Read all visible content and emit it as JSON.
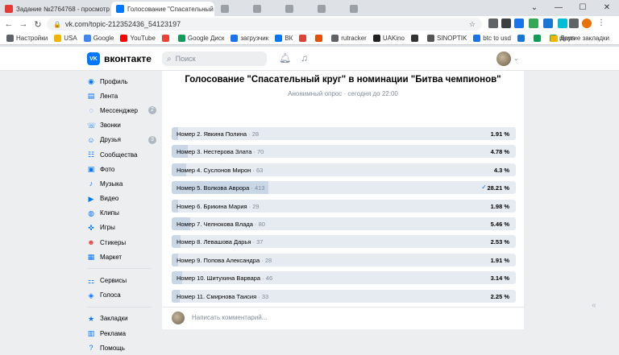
{
  "browser": {
    "tabs": [
      {
        "title": "Задание №2764768 - просмотр з",
        "icon": "sp-icon",
        "color": "#e53935"
      },
      {
        "title": "Голосование \"Спасательный круг",
        "icon": "vk-icon",
        "color": "#0077ff"
      },
      {
        "title": "",
        "icon": "page-icon",
        "color": "#9aa0a6"
      },
      {
        "title": "",
        "icon": "page-icon",
        "color": "#9aa0a6"
      },
      {
        "title": "",
        "icon": "page-icon",
        "color": "#9aa0a6"
      },
      {
        "title": "",
        "icon": "page-icon",
        "color": "#9aa0a6"
      },
      {
        "title": "",
        "icon": "page-icon",
        "color": "#9aa0a6"
      }
    ],
    "url": "vk.com/topic-212352436_54123197",
    "bookmarks": [
      {
        "label": "Настройки",
        "color": "#5f6368"
      },
      {
        "label": "USA",
        "color": "#f4b400"
      },
      {
        "label": "Google",
        "color": "#4285f4"
      },
      {
        "label": "YouTube",
        "color": "#ff0000"
      },
      {
        "label": "",
        "color": "#ea4335"
      },
      {
        "label": "Google Диск",
        "color": "#0f9d58"
      },
      {
        "label": "загрузчик",
        "color": "#1a73e8"
      },
      {
        "label": "ВК",
        "color": "#0077ff"
      },
      {
        "label": "",
        "color": "#db4437"
      },
      {
        "label": "",
        "color": "#e65100"
      },
      {
        "label": "rutracker",
        "color": "#5f6368"
      },
      {
        "label": "UAKino",
        "color": "#222222"
      },
      {
        "label": "",
        "color": "#333333"
      },
      {
        "label": "SINOPTIK",
        "color": "#555555"
      },
      {
        "label": "btc to usd",
        "color": "#1a73e8"
      },
      {
        "label": "",
        "color": "#1976d2"
      },
      {
        "label": "",
        "color": "#0f9d58"
      },
      {
        "label": "maps",
        "color": "#34a853"
      }
    ],
    "other_bookmarks": "Другие закладки"
  },
  "vk": {
    "logo_text": "вконтакте",
    "search_placeholder": "Поиск",
    "sidebar": [
      {
        "label": "Профиль",
        "icon": "profile-icon",
        "badge": ""
      },
      {
        "label": "Лента",
        "icon": "feed-icon",
        "badge": ""
      },
      {
        "label": "Мессенджер",
        "icon": "messenger-icon",
        "badge": "2"
      },
      {
        "label": "Звонки",
        "icon": "calls-icon",
        "badge": ""
      },
      {
        "label": "Друзья",
        "icon": "friends-icon",
        "badge": "3"
      },
      {
        "label": "Сообщества",
        "icon": "communities-icon",
        "badge": ""
      },
      {
        "label": "Фото",
        "icon": "photo-icon",
        "badge": ""
      },
      {
        "label": "Музыка",
        "icon": "music-icon",
        "badge": ""
      },
      {
        "label": "Видео",
        "icon": "video-icon",
        "badge": ""
      },
      {
        "label": "Клипы",
        "icon": "clips-icon",
        "badge": ""
      },
      {
        "label": "Игры",
        "icon": "games-icon",
        "badge": ""
      },
      {
        "label": "Стикеры",
        "icon": "stickers-icon",
        "badge": ""
      },
      {
        "label": "Маркет",
        "icon": "market-icon",
        "badge": ""
      }
    ],
    "sidebar2": [
      {
        "label": "Сервисы",
        "icon": "services-icon"
      },
      {
        "label": "Голоса",
        "icon": "votes-icon"
      }
    ],
    "sidebar3": [
      {
        "label": "Закладки",
        "icon": "bookmarks-icon"
      },
      {
        "label": "Реклама",
        "icon": "ads-icon"
      },
      {
        "label": "Помощь",
        "icon": "help-icon"
      }
    ]
  },
  "poll": {
    "title": "Голосование \"Спасательный круг\" в номинации \"Битва чемпионов\"",
    "subtitle": "Анонимный опрос · сегодня до 22:00",
    "options": [
      {
        "label": "Номер 2. Явкина Полина",
        "count": "28",
        "percent": "1.91 %",
        "value": 1.91,
        "voted": false
      },
      {
        "label": "Номер 3. Нестерова Злата",
        "count": "70",
        "percent": "4.78 %",
        "value": 4.78,
        "voted": false
      },
      {
        "label": "Номер 4. Суслонов Мирон",
        "count": "63",
        "percent": "4.3 %",
        "value": 4.3,
        "voted": false
      },
      {
        "label": "Номер 5. Волкова Аврора",
        "count": "413",
        "percent": "28.21 %",
        "value": 28.21,
        "voted": true
      },
      {
        "label": "Номер 6. Брикина Мария",
        "count": "29",
        "percent": "1.98 %",
        "value": 1.98,
        "voted": false
      },
      {
        "label": "Номер 7. Челнокова Влада",
        "count": "80",
        "percent": "5.46 %",
        "value": 5.46,
        "voted": false
      },
      {
        "label": "Номер 8. Левашова Дарья",
        "count": "37",
        "percent": "2.53 %",
        "value": 2.53,
        "voted": false
      },
      {
        "label": "Номер 9. Попова Александра",
        "count": "28",
        "percent": "1.91 %",
        "value": 1.91,
        "voted": false
      },
      {
        "label": "Номер 10. Шитухина Варвара",
        "count": "46",
        "percent": "3.14 %",
        "value": 3.14,
        "voted": false
      },
      {
        "label": "Номер 11. Смирнова Таисия",
        "count": "33",
        "percent": "2.25 %",
        "value": 2.25,
        "voted": false
      }
    ],
    "comment_placeholder": "Написать комментарий..."
  }
}
